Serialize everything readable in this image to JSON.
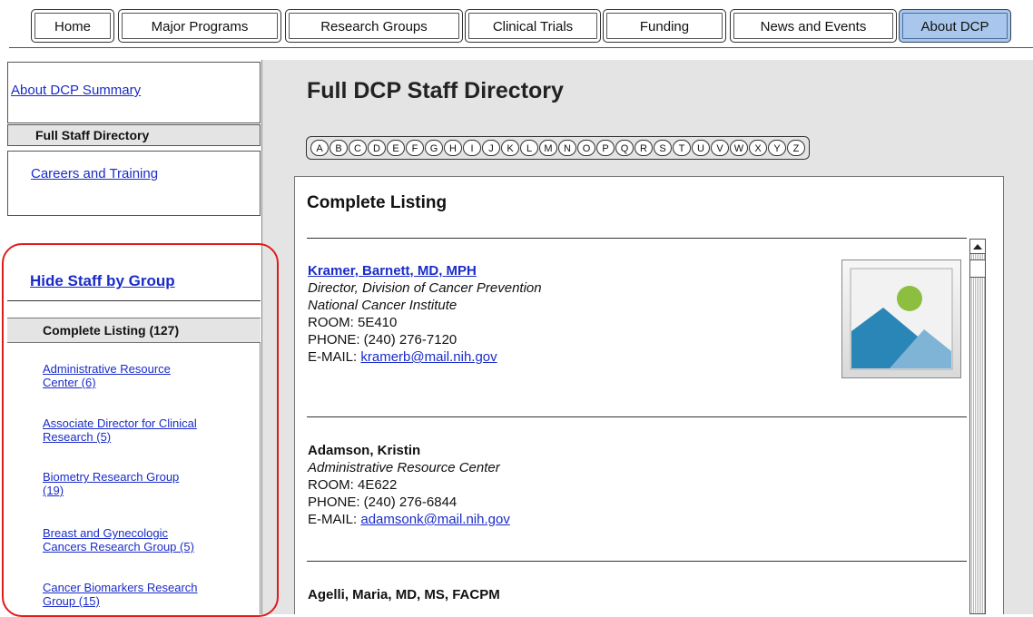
{
  "tabs": [
    {
      "label": "Home"
    },
    {
      "label": "Major Programs"
    },
    {
      "label": "Research Groups"
    },
    {
      "label": "Clinical Trials"
    },
    {
      "label": "Funding"
    },
    {
      "label": "News and Events"
    },
    {
      "label": "About DCP",
      "active": true
    }
  ],
  "sidebar": {
    "summary_link": "About DCP Summary",
    "current_page": "Full Staff Directory",
    "careers_link": "Careers and Training",
    "groups_toggle": "Hide Staff by Group",
    "complete_listing": "Complete Listing (127)",
    "groups": [
      {
        "line1": "Administrative Resource",
        "line2": "Center (6)"
      },
      {
        "line1": "Associate Director for Clinical",
        "line2": "Research (5)"
      },
      {
        "line1": "Biometry Research Group",
        "line2": "(19)"
      },
      {
        "line1": "Breast and Gynecologic",
        "line2": "Cancers Research Group (5)"
      },
      {
        "line1": "Cancer Biomarkers Research",
        "line2": "Group (15)"
      }
    ]
  },
  "main": {
    "title": "Full DCP Staff Directory",
    "alphabet": [
      "A",
      "B",
      "C",
      "D",
      "E",
      "F",
      "G",
      "H",
      "I",
      "J",
      "K",
      "L",
      "M",
      "N",
      "O",
      "P",
      "Q",
      "R",
      "S",
      "T",
      "U",
      "V",
      "W",
      "X",
      "Y",
      "Z"
    ],
    "listing_title": "Complete Listing",
    "entries": [
      {
        "name": "Kramer, Barnett, MD, MPH",
        "title": "Director, Division of Cancer Prevention",
        "org": "National Cancer Institute",
        "room": "ROOM: 5E410",
        "phone": "PHONE: (240) 276-7120",
        "email_label": "E-MAIL:",
        "email": "kramerb@mail.nih.gov"
      },
      {
        "name": "Adamson, Kristin",
        "title": "Administrative Resource Center",
        "room": "ROOM: 4E622",
        "phone": "PHONE: (240) 276-6844",
        "email_label": "E-MAIL:",
        "email": "adamsonk@mail.nih.gov"
      },
      {
        "name": "Agelli, Maria, MD, MS, FACPM"
      }
    ]
  },
  "colors": {
    "active_tab": "#a9c7ec",
    "link": "#1a2cc8",
    "highlight_ring": "#e01b1b",
    "panel_gray": "#e4e4e4"
  }
}
